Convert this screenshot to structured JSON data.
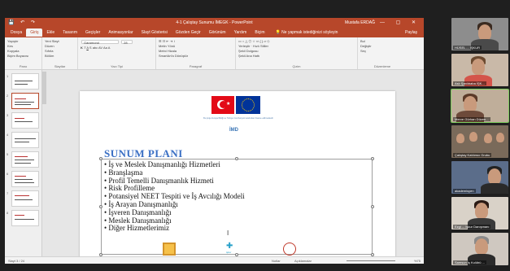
{
  "powerpoint": {
    "title": "4-1 Çalıştay Sunumu İMEGK - PowerPoint",
    "user": "Mustafa ERDAĞ",
    "tabs": [
      "Dosya",
      "Giriş",
      "Ekle",
      "Tasarım",
      "Geçişler",
      "Animasyonlar",
      "Slayt Gösterisi",
      "Gözden Geçir",
      "Görünüm",
      "Yardım",
      "Biçim"
    ],
    "active_tab": "Giriş",
    "tellme": "Ne yapmak istediğinizi söyleyin",
    "share": "Paylaş",
    "ribbon": {
      "clipboard": {
        "label": "Pano",
        "paste": "Yapıştır",
        "cut": "Kes",
        "copy": "Kopyala",
        "format_painter": "Biçim Boyacısı"
      },
      "slides": {
        "label": "Slaytlar",
        "new": "Yeni Slayt",
        "layout": "Düzen",
        "reset": "Sıfırla",
        "section": "Bölüm"
      },
      "font": {
        "label": "Yazı Tipi",
        "name": "Garamond",
        "size": "28"
      },
      "paragraph": {
        "label": "Paragraf",
        "text_direction": "Metin Yönü",
        "align_text": "Metni Hizala",
        "smartart": "SmartArt'a Dönüştür"
      },
      "drawing": {
        "label": "Çizim",
        "arrange": "Yerleştir",
        "quick_styles": "Hızlı Stiller",
        "fill": "Şekil Dolgusu",
        "outline": "Şekil Ana Hattı",
        "effects": "Şekil Efektleri"
      },
      "editing": {
        "label": "Düzenleme",
        "find": "Bul",
        "replace": "Değiştir",
        "select": "Seç"
      }
    },
    "slide": {
      "flag_caption": "Bu proje Avrupa Birliği ve Türkiye Cumhuriyeti tarafından finanse edilmektedir",
      "imd_logo": "İMD",
      "title": "SUNUM PLANI",
      "bullets": [
        "İş ve Meslek Danışmanlığı Hizmetleri",
        "Branşlaşma",
        "Profil Temelli Danışmanlık Hizmeti",
        "Risk Profilleme",
        "Potansiyel NEET Tespiti ve İş Avcılığı Modeli",
        "İş Arayan Danışmanlığı",
        "İşveren Danışmanlığı",
        "Meslek Danışmanlığı",
        "Diğer Hizmetlerimiz"
      ],
      "footer_logo2": "işkur"
    },
    "thumbnails": [
      "1",
      "2",
      "3",
      "4",
      "5",
      "6",
      "7",
      "8"
    ],
    "status": {
      "slide_info": "Slayt 3 / 24",
      "notes": "Notlar",
      "comments": "Açıklamalar",
      "zoom": "%75"
    }
  },
  "participants": [
    {
      "name": "HÜSEL ... İŞKUR"
    },
    {
      "name": "Aslı Şanlıbaba İŞK..."
    },
    {
      "name": "Merve Gürhan Düzen..."
    },
    {
      "name": "Çalıştay Katılımcı Grubu"
    },
    {
      "name": "akademisyen"
    },
    {
      "name": "Ezgi ... İşkur Danışmanı"
    },
    {
      "name": "Samsun İş Kulübü ..."
    }
  ],
  "colors": {
    "accent": "#b7472a",
    "title_blue": "#3a6fc4",
    "active_speaker": "#7ccb5c"
  }
}
